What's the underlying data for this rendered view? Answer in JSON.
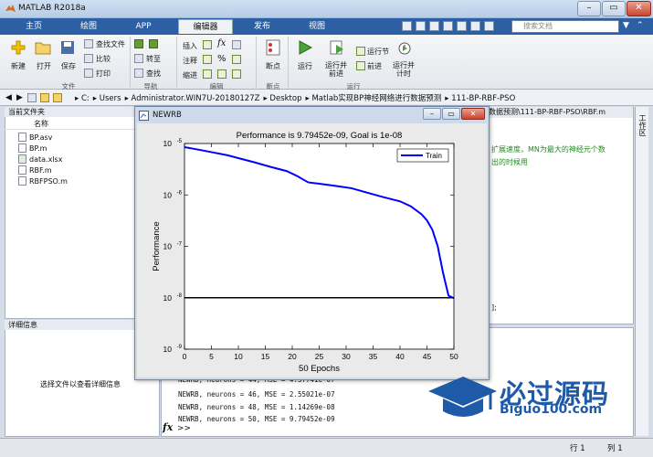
{
  "window": {
    "title": "MATLAB R2018a"
  },
  "tabs": [
    {
      "label": "主页"
    },
    {
      "label": "绘图"
    },
    {
      "label": "APP"
    },
    {
      "label": "编辑器"
    },
    {
      "label": "发布"
    },
    {
      "label": "视图"
    }
  ],
  "search": {
    "placeholder": "搜索文档"
  },
  "ribbon": {
    "file": {
      "new": "新建",
      "open": "打开",
      "save": "保存",
      "find_files": "查找文件",
      "compare": "比较",
      "print": "打印",
      "group": "文件"
    },
    "nav": {
      "goto": "转至",
      "find": "查找",
      "group": "导航"
    },
    "edit": {
      "insert": "插入",
      "comment": "注释",
      "indent": "缩进",
      "fx": "fx",
      "group": "编辑"
    },
    "breakpoints": {
      "label": "断点",
      "group": "断点"
    },
    "run": {
      "run": "运行",
      "run_advance": "运行并\n前进",
      "run_section": "运行节",
      "advance": "前进",
      "run_time": "运行并\n计时",
      "group": "运行"
    }
  },
  "path": [
    "C:",
    "Users",
    "Administrator.WIN7U-20180127Z",
    "Desktop",
    "Matlab实现BP神经网络进行数据预测",
    "111-BP-RBF-PSO"
  ],
  "files_panel": {
    "title": "当前文件夹",
    "column": "名称",
    "files": [
      {
        "name": "BP.asv"
      },
      {
        "name": "BP.m"
      },
      {
        "name": "data.xlsx"
      },
      {
        "name": "RBF.m"
      },
      {
        "name": "RBFPSO.m"
      }
    ]
  },
  "details_panel": {
    "title": "详细信息",
    "hint": "选择文件以查看详细信息"
  },
  "editor": {
    "path": "数据预测\\111-BP-RBF-PSO\\RBF.m",
    "line1": "扩展速度，MN为最大的神经元个数",
    "line2": "出的时候用",
    "line3": "];"
  },
  "workspace_label": "工作区",
  "command": {
    "lines": [
      "NEWRB, neurons = 44, MSE = 4.37741e-07",
      "NEWRB, neurons = 46, MSE = 2.55021e-07",
      "NEWRB, neurons = 48, MSE = 1.14269e-08",
      "NEWRB, neurons = 50, MSE = 9.79452e-09"
    ],
    "fx": "fx",
    "prompt": ">>"
  },
  "status": {
    "row_label": "行",
    "row": "1",
    "col_label": "列",
    "col": "1"
  },
  "figure": {
    "title": "NEWRB"
  },
  "watermark": {
    "text": "必过源码",
    "sub": "Biguo100.com"
  },
  "chart_data": {
    "type": "line",
    "title": "Performance is 9.79452e-09, Goal is 1e-08",
    "xlabel": "50 Epochs",
    "ylabel": "Performance",
    "xlim": [
      0,
      50
    ],
    "ylim_log10": [
      -9,
      -5
    ],
    "xticks": [
      "0",
      "5",
      "10",
      "15",
      "20",
      "25",
      "30",
      "35",
      "40",
      "45",
      "50"
    ],
    "yticks": [
      "10^-9",
      "10^-8",
      "10^-7",
      "10^-6",
      "10^-5"
    ],
    "legend": {
      "placement": "top-right",
      "entries": [
        "Train"
      ]
    },
    "series": [
      {
        "name": "Train",
        "color": "#0000ff",
        "x": [
          0,
          2,
          5,
          8,
          10,
          13,
          16,
          19,
          21,
          22,
          23,
          25,
          28,
          31,
          34,
          37,
          40,
          42,
          44,
          45,
          46,
          47,
          48,
          49,
          50
        ],
        "y": [
          8.5e-06,
          7.8e-06,
          6.8e-06,
          5.9e-06,
          5.2e-06,
          4.3e-06,
          3.5e-06,
          2.9e-06,
          2.3e-06,
          2e-06,
          1.75e-06,
          1.65e-06,
          1.5e-06,
          1.35e-06,
          1.1e-06,
          9e-07,
          7.5e-07,
          6e-07,
          4.2e-07,
          3.2e-07,
          2.1e-07,
          1e-07,
          3e-08,
          1.1e-08,
          9.79452e-09
        ]
      },
      {
        "name": "",
        "color": "#000000",
        "x": [
          0,
          50
        ],
        "y": [
          1e-08,
          1e-08
        ]
      }
    ],
    "grid": false
  }
}
